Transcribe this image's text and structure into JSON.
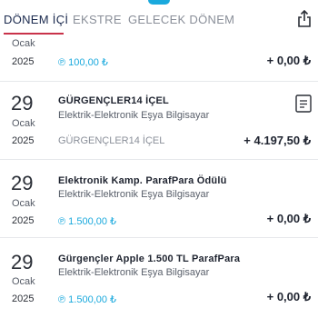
{
  "tabs": [
    {
      "label": "DÖNEM İÇİ"
    },
    {
      "label": "EKSTRE"
    },
    {
      "label": "GELECEK DÖNEM"
    }
  ],
  "partial_row": {
    "month": "Ocak",
    "year": "2025",
    "points": "℗ 100,00 ₺",
    "amount": "+ 0,00 ₺"
  },
  "transactions": [
    {
      "day": "29",
      "month": "Ocak",
      "year": "2025",
      "title": "GÜRGENÇLER14 İÇEL",
      "category": "Elektrik-Elektronik Eşya Bilgisayar",
      "merchant": "GÜRGENÇLER14 İÇEL",
      "amount": "+ 4.197,50 ₺"
    },
    {
      "day": "29",
      "month": "Ocak",
      "year": "2025",
      "title": "Elektronik Kamp. ParafPara Ödülü",
      "category": "Elektrik-Elektronik Eşya Bilgisayar",
      "points": "℗ 1.500,00 ₺",
      "amount": "+ 0,00 ₺"
    },
    {
      "day": "29",
      "month": "Ocak",
      "year": "2025",
      "title": "Gürgençler Apple 1.500 TL ParafPara",
      "category": "Elektrik-Elektronik Eşya Bilgisayar",
      "points": "℗ 1.500,00 ₺",
      "amount": "+ 0,00 ₺"
    }
  ],
  "colors": {
    "accent": "#1aa9dd",
    "tab_underline": "#c9324a",
    "active_tab": "#1b2a4e"
  },
  "icons": {
    "share": "share-icon",
    "document": "document-icon"
  }
}
